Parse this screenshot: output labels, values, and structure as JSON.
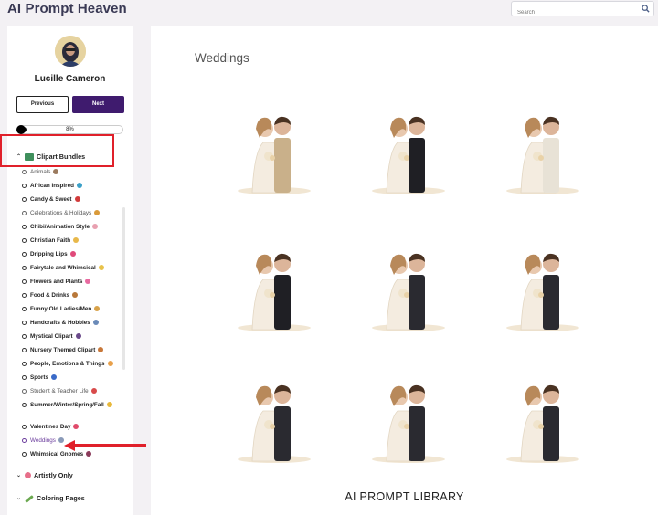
{
  "brand": "AI Prompt Heaven",
  "search": {
    "placeholder": "Search"
  },
  "user": {
    "name": "Lucille Cameron"
  },
  "nav": {
    "previous_label": "Previous",
    "next_label": "Next"
  },
  "progress": {
    "fraction": 0.08,
    "text": "8%"
  },
  "sidebar": {
    "sections": [
      {
        "label": "Clipart Bundles",
        "expanded": true
      },
      {
        "label": "Artistly Only",
        "expanded": false
      },
      {
        "label": "Coloring Pages",
        "expanded": false
      }
    ],
    "items": [
      {
        "label": "Animals",
        "completed": true
      },
      {
        "label": "African Inspired",
        "completed": false
      },
      {
        "label": "Candy & Sweet",
        "completed": false
      },
      {
        "label": "Celebrations & Holidays",
        "completed": true
      },
      {
        "label": "Chibi/Animation Style",
        "completed": false
      },
      {
        "label": "Christian Faith",
        "completed": false
      },
      {
        "label": "Dripping Lips",
        "completed": false
      },
      {
        "label": "Fairytale and Whimsical",
        "completed": false
      },
      {
        "label": "Flowers and Plants",
        "completed": false
      },
      {
        "label": "Food & Drinks",
        "completed": false
      },
      {
        "label": "Funny Old Ladies/Men",
        "completed": false
      },
      {
        "label": "Handcrafts & Hobbies",
        "completed": false
      },
      {
        "label": "Mystical Clipart",
        "completed": false
      },
      {
        "label": "Nursery Themed Clipart",
        "completed": false
      },
      {
        "label": "People, Emotions & Things",
        "completed": false
      },
      {
        "label": "Sports",
        "completed": false
      },
      {
        "label": "Student & Teacher Life",
        "completed": true
      },
      {
        "label": "Summer/Winter/Spring/Fall",
        "completed": false
      },
      {
        "label": "Valentines Day",
        "completed": false
      },
      {
        "label": "Weddings",
        "completed": true,
        "active": true
      },
      {
        "label": "Whimsical Gnomes",
        "completed": false
      }
    ]
  },
  "main": {
    "title": "Weddings",
    "images": [
      "couple-embrace-bride-tiara",
      "couple-kiss-brown-suit",
      "couple-closeup-bouquet",
      "couple-bride-bouquet-close",
      "couple-twirl-dancing",
      "couple-holding-hands-standing",
      "couple-walking-dress-flowing",
      "couple-kiss-standing",
      "couple-walking-black-suit"
    ],
    "footer_title": "AI PROMPT LIBRARY"
  },
  "colors": {
    "accent": "#3f1b6e",
    "highlight": "#e0202a",
    "active_item": "#6a3b9c"
  }
}
